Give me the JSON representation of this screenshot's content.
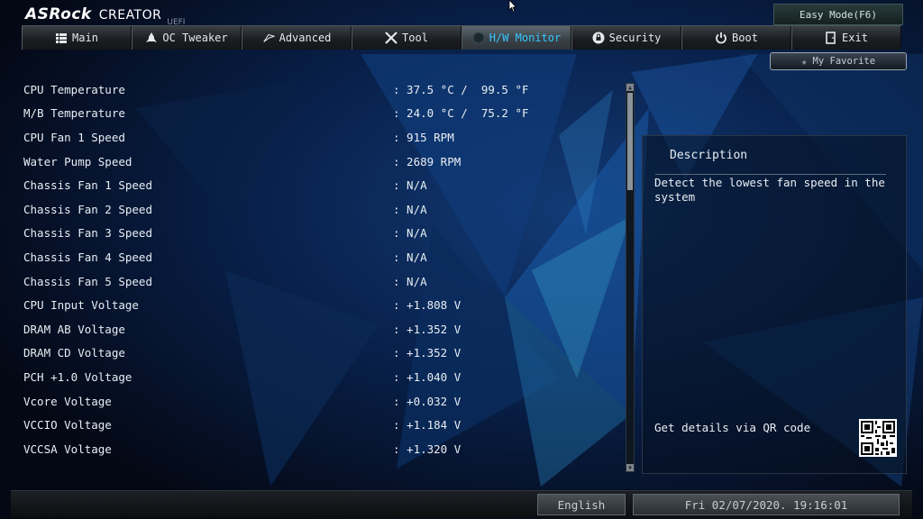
{
  "header": {
    "brand": "ASRock",
    "product": "CREATOR",
    "uefi": "UEFI",
    "easy_mode": "Easy Mode(F6)",
    "my_favorite": "My Favorite"
  },
  "tabs": [
    {
      "label": "Main",
      "icon": "list-icon"
    },
    {
      "label": "OC Tweaker",
      "icon": "rocket-icon"
    },
    {
      "label": "Advanced",
      "icon": "star-icon"
    },
    {
      "label": "Tool",
      "icon": "tools-icon"
    },
    {
      "label": "H/W Monitor",
      "icon": "monitor-icon",
      "active": true
    },
    {
      "label": "Security",
      "icon": "shield-icon"
    },
    {
      "label": "Boot",
      "icon": "power-icon"
    },
    {
      "label": "Exit",
      "icon": "exit-icon"
    }
  ],
  "monitor": [
    {
      "label": "CPU Temperature",
      "value": ": 37.5 °C /  99.5 °F"
    },
    {
      "label": "M/B Temperature",
      "value": ": 24.0 °C /  75.2 °F"
    },
    {
      "label": "CPU Fan 1 Speed",
      "value": ": 915 RPM"
    },
    {
      "label": "Water Pump Speed",
      "value": ": 2689 RPM"
    },
    {
      "label": "Chassis Fan 1 Speed",
      "value": ": N/A"
    },
    {
      "label": "Chassis Fan 2 Speed",
      "value": ": N/A"
    },
    {
      "label": "Chassis Fan 3 Speed",
      "value": ": N/A"
    },
    {
      "label": "Chassis Fan 4 Speed",
      "value": ": N/A"
    },
    {
      "label": "Chassis Fan 5 Speed",
      "value": ": N/A"
    },
    {
      "label": "CPU Input Voltage",
      "value": ": +1.808 V"
    },
    {
      "label": "DRAM AB Voltage",
      "value": ": +1.352 V"
    },
    {
      "label": "DRAM CD Voltage",
      "value": ": +1.352 V"
    },
    {
      "label": "PCH +1.0 Voltage",
      "value": ": +1.040 V"
    },
    {
      "label": "Vcore Voltage",
      "value": ": +0.032 V"
    },
    {
      "label": "VCCIO Voltage",
      "value": ": +1.184 V"
    },
    {
      "label": "VCCSA Voltage",
      "value": ": +1.320 V"
    }
  ],
  "description": {
    "title": "Description",
    "text": "Detect the lowest fan speed in the system",
    "qr_label": "Get details via QR code"
  },
  "footer": {
    "language": "English",
    "datetime": "Fri 02/07/2020. 19:16:01"
  },
  "colors": {
    "accent": "#35c8ff",
    "background": "#050a18"
  }
}
